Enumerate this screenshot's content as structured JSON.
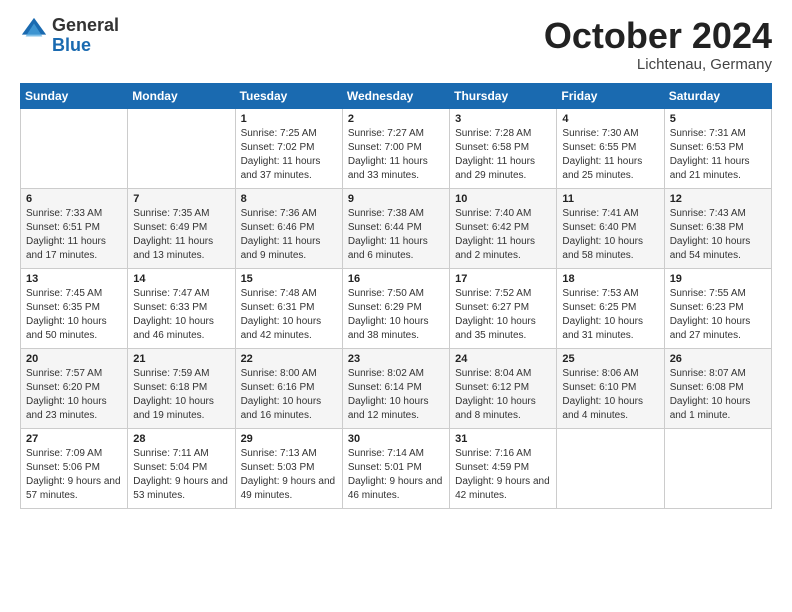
{
  "header": {
    "logo_general": "General",
    "logo_blue": "Blue",
    "month_title": "October 2024",
    "location": "Lichtenau, Germany"
  },
  "days_of_week": [
    "Sunday",
    "Monday",
    "Tuesday",
    "Wednesday",
    "Thursday",
    "Friday",
    "Saturday"
  ],
  "weeks": [
    [
      {
        "day": "",
        "info": ""
      },
      {
        "day": "",
        "info": ""
      },
      {
        "day": "1",
        "info": "Sunrise: 7:25 AM\nSunset: 7:02 PM\nDaylight: 11 hours and 37 minutes."
      },
      {
        "day": "2",
        "info": "Sunrise: 7:27 AM\nSunset: 7:00 PM\nDaylight: 11 hours and 33 minutes."
      },
      {
        "day": "3",
        "info": "Sunrise: 7:28 AM\nSunset: 6:58 PM\nDaylight: 11 hours and 29 minutes."
      },
      {
        "day": "4",
        "info": "Sunrise: 7:30 AM\nSunset: 6:55 PM\nDaylight: 11 hours and 25 minutes."
      },
      {
        "day": "5",
        "info": "Sunrise: 7:31 AM\nSunset: 6:53 PM\nDaylight: 11 hours and 21 minutes."
      }
    ],
    [
      {
        "day": "6",
        "info": "Sunrise: 7:33 AM\nSunset: 6:51 PM\nDaylight: 11 hours and 17 minutes."
      },
      {
        "day": "7",
        "info": "Sunrise: 7:35 AM\nSunset: 6:49 PM\nDaylight: 11 hours and 13 minutes."
      },
      {
        "day": "8",
        "info": "Sunrise: 7:36 AM\nSunset: 6:46 PM\nDaylight: 11 hours and 9 minutes."
      },
      {
        "day": "9",
        "info": "Sunrise: 7:38 AM\nSunset: 6:44 PM\nDaylight: 11 hours and 6 minutes."
      },
      {
        "day": "10",
        "info": "Sunrise: 7:40 AM\nSunset: 6:42 PM\nDaylight: 11 hours and 2 minutes."
      },
      {
        "day": "11",
        "info": "Sunrise: 7:41 AM\nSunset: 6:40 PM\nDaylight: 10 hours and 58 minutes."
      },
      {
        "day": "12",
        "info": "Sunrise: 7:43 AM\nSunset: 6:38 PM\nDaylight: 10 hours and 54 minutes."
      }
    ],
    [
      {
        "day": "13",
        "info": "Sunrise: 7:45 AM\nSunset: 6:35 PM\nDaylight: 10 hours and 50 minutes."
      },
      {
        "day": "14",
        "info": "Sunrise: 7:47 AM\nSunset: 6:33 PM\nDaylight: 10 hours and 46 minutes."
      },
      {
        "day": "15",
        "info": "Sunrise: 7:48 AM\nSunset: 6:31 PM\nDaylight: 10 hours and 42 minutes."
      },
      {
        "day": "16",
        "info": "Sunrise: 7:50 AM\nSunset: 6:29 PM\nDaylight: 10 hours and 38 minutes."
      },
      {
        "day": "17",
        "info": "Sunrise: 7:52 AM\nSunset: 6:27 PM\nDaylight: 10 hours and 35 minutes."
      },
      {
        "day": "18",
        "info": "Sunrise: 7:53 AM\nSunset: 6:25 PM\nDaylight: 10 hours and 31 minutes."
      },
      {
        "day": "19",
        "info": "Sunrise: 7:55 AM\nSunset: 6:23 PM\nDaylight: 10 hours and 27 minutes."
      }
    ],
    [
      {
        "day": "20",
        "info": "Sunrise: 7:57 AM\nSunset: 6:20 PM\nDaylight: 10 hours and 23 minutes."
      },
      {
        "day": "21",
        "info": "Sunrise: 7:59 AM\nSunset: 6:18 PM\nDaylight: 10 hours and 19 minutes."
      },
      {
        "day": "22",
        "info": "Sunrise: 8:00 AM\nSunset: 6:16 PM\nDaylight: 10 hours and 16 minutes."
      },
      {
        "day": "23",
        "info": "Sunrise: 8:02 AM\nSunset: 6:14 PM\nDaylight: 10 hours and 12 minutes."
      },
      {
        "day": "24",
        "info": "Sunrise: 8:04 AM\nSunset: 6:12 PM\nDaylight: 10 hours and 8 minutes."
      },
      {
        "day": "25",
        "info": "Sunrise: 8:06 AM\nSunset: 6:10 PM\nDaylight: 10 hours and 4 minutes."
      },
      {
        "day": "26",
        "info": "Sunrise: 8:07 AM\nSunset: 6:08 PM\nDaylight: 10 hours and 1 minute."
      }
    ],
    [
      {
        "day": "27",
        "info": "Sunrise: 7:09 AM\nSunset: 5:06 PM\nDaylight: 9 hours and 57 minutes."
      },
      {
        "day": "28",
        "info": "Sunrise: 7:11 AM\nSunset: 5:04 PM\nDaylight: 9 hours and 53 minutes."
      },
      {
        "day": "29",
        "info": "Sunrise: 7:13 AM\nSunset: 5:03 PM\nDaylight: 9 hours and 49 minutes."
      },
      {
        "day": "30",
        "info": "Sunrise: 7:14 AM\nSunset: 5:01 PM\nDaylight: 9 hours and 46 minutes."
      },
      {
        "day": "31",
        "info": "Sunrise: 7:16 AM\nSunset: 4:59 PM\nDaylight: 9 hours and 42 minutes."
      },
      {
        "day": "",
        "info": ""
      },
      {
        "day": "",
        "info": ""
      }
    ]
  ]
}
